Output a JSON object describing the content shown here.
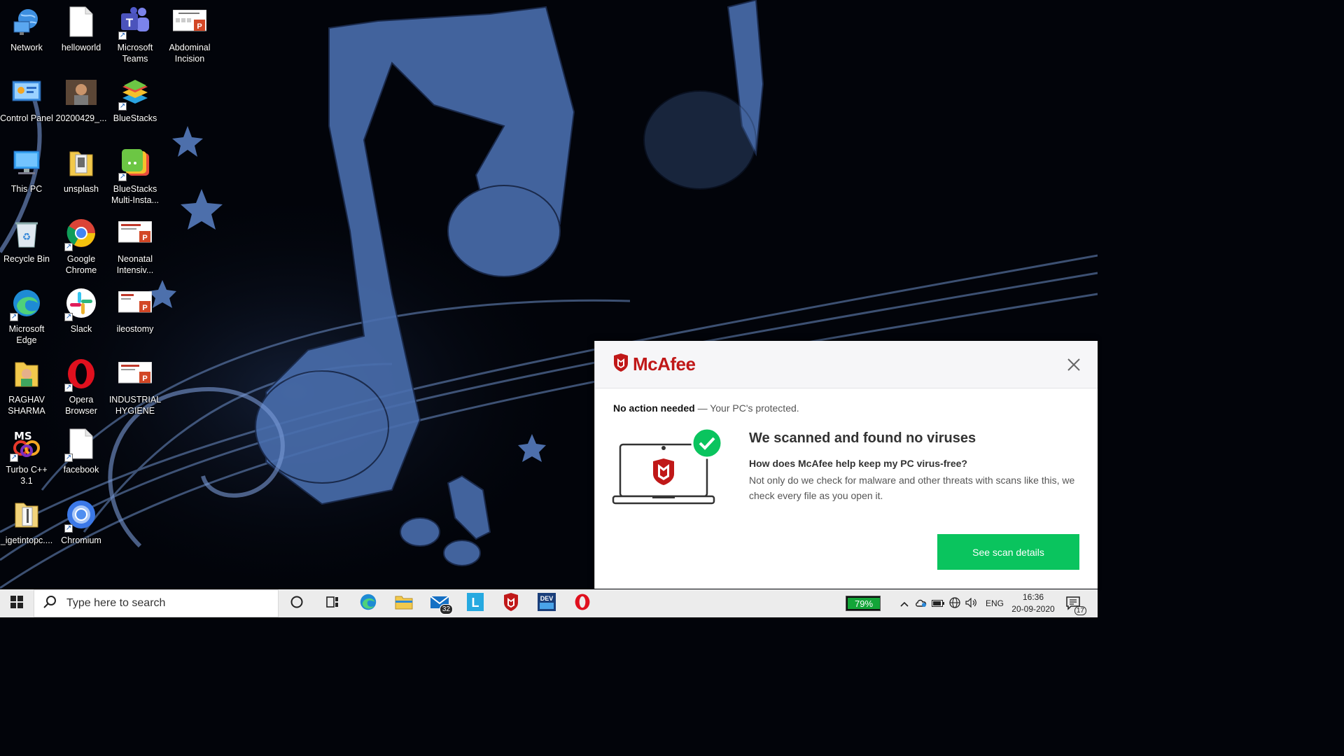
{
  "desktop": {
    "icons": [
      {
        "label": "Network",
        "icon": "network-icon"
      },
      {
        "label": "helloworld",
        "icon": "text-file-icon"
      },
      {
        "label": "Microsoft Teams",
        "icon": "teams-icon"
      },
      {
        "label": "Abdominal Incision",
        "icon": "powerpoint-file-icon"
      },
      {
        "label": "Control Panel",
        "icon": "control-panel-icon"
      },
      {
        "label": "20200429_...",
        "icon": "photo-file-icon"
      },
      {
        "label": "BlueStacks",
        "icon": "bluestacks-icon"
      },
      {
        "label": "This PC",
        "icon": "this-pc-icon"
      },
      {
        "label": "unsplash",
        "icon": "folder-icon"
      },
      {
        "label": "BlueStacks Multi-Insta...",
        "icon": "bluestacks-multi-icon"
      },
      {
        "label": "Recycle Bin",
        "icon": "recycle-bin-icon"
      },
      {
        "label": "Google Chrome",
        "icon": "chrome-icon"
      },
      {
        "label": "Neonatal Intensiv...",
        "icon": "powerpoint-file-icon"
      },
      {
        "label": "Microsoft Edge",
        "icon": "edge-icon"
      },
      {
        "label": "Slack",
        "icon": "slack-icon"
      },
      {
        "label": "ileostomy",
        "icon": "powerpoint-file-icon"
      },
      {
        "label": "RAGHAV SHARMA",
        "icon": "user-folder-icon"
      },
      {
        "label": "Opera Browser",
        "icon": "opera-icon"
      },
      {
        "label": "INDUSTRIAL HYGIENE",
        "icon": "powerpoint-file-icon"
      },
      {
        "label": "Turbo C++ 3.1",
        "icon": "turbo-cpp-icon"
      },
      {
        "label": "facebook",
        "icon": "text-file-icon"
      },
      {
        "label": "_igetintopc....",
        "icon": "zip-folder-icon"
      },
      {
        "label": "Chromium",
        "icon": "chromium-icon"
      }
    ]
  },
  "mcafee": {
    "brand": "McAfee",
    "status_bold": "No action needed",
    "status_rest": " — Your PC's protected.",
    "title": "We scanned and found no viruses",
    "question": "How does McAfee help keep my PC virus-free?",
    "body": "Not only do we check for malware and other threats with scans like this, we check every file as you open it.",
    "button": "See scan details",
    "brand_color": "#c01818",
    "button_color": "#0ac45e"
  },
  "taskbar": {
    "search_placeholder": "Type here to search",
    "mail_badge": "32",
    "battery_percent": "79%",
    "language": "ENG",
    "time": "16:36",
    "date": "20-09-2020",
    "notifications_count": "17",
    "pinned": [
      "cortana-icon",
      "task-view-icon",
      "edge-icon",
      "file-explorer-icon",
      "mail-icon",
      "l-app-icon",
      "mcafee-icon",
      "devc-icon",
      "opera-icon"
    ]
  }
}
